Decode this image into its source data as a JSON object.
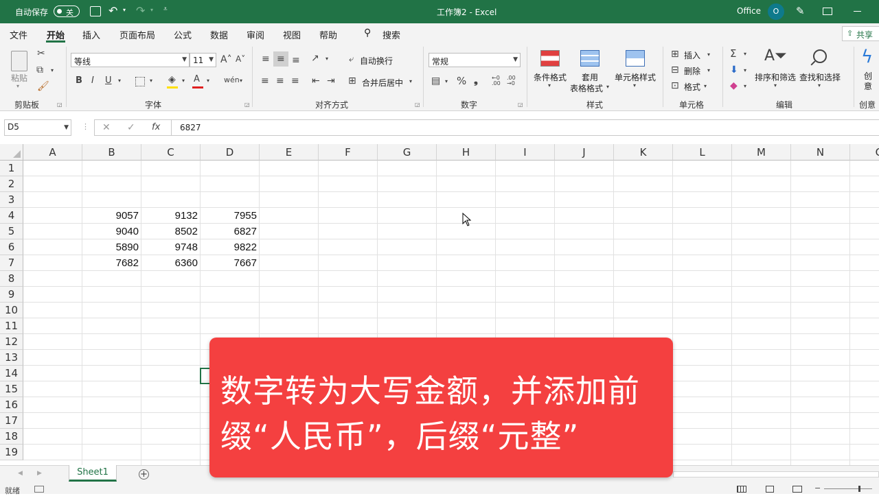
{
  "title_bar": {
    "autosave_label": "自动保存",
    "autosave_toggle": "关",
    "doc_title": "工作簿2  -  Excel",
    "account": "Office",
    "avatar_initial": "O",
    "bg_color": "#217346"
  },
  "menu": {
    "items": [
      "文件",
      "开始",
      "插入",
      "页面布局",
      "公式",
      "数据",
      "审阅",
      "视图",
      "帮助"
    ],
    "active": "开始",
    "search": "搜索",
    "share": "共享"
  },
  "ribbon": {
    "clipboard": {
      "paste": "粘贴",
      "group": "剪贴板"
    },
    "font": {
      "family": "等线",
      "size": "11",
      "group": "字体"
    },
    "align": {
      "wrap": "自动换行",
      "merge": "合并后居中",
      "group": "对齐方式"
    },
    "number": {
      "format": "常规",
      "group": "数字"
    },
    "styles": {
      "cond": "条件格式",
      "table_a": "套用",
      "table_b": "表格格式",
      "cell": "单元格样式",
      "group": "样式"
    },
    "cells": {
      "insert": "插入",
      "delete": "删除",
      "format": "格式",
      "group": "单元格"
    },
    "editing": {
      "sort": "排序和筛选",
      "find": "查找和选择",
      "group": "编辑"
    },
    "creative": {
      "label": "创意",
      "group": "创意"
    }
  },
  "formula_bar": {
    "name_box": "D5",
    "fx": "fx",
    "value": "6827"
  },
  "columns": [
    "A",
    "B",
    "C",
    "D",
    "E",
    "F",
    "G",
    "H",
    "I",
    "J",
    "K",
    "L",
    "M",
    "N",
    "O"
  ],
  "rows": [
    "1",
    "2",
    "3",
    "4",
    "5",
    "6",
    "7",
    "8",
    "9",
    "10",
    "11",
    "12",
    "13",
    "14",
    "15",
    "16",
    "17",
    "18",
    "19"
  ],
  "table": [
    [
      "9057",
      "9132",
      "7955"
    ],
    [
      "9040",
      "8502",
      "6827"
    ],
    [
      "5890",
      "9748",
      "9822"
    ],
    [
      "7682",
      "6360",
      "7667"
    ]
  ],
  "sheets": {
    "tabs": [
      "Sheet1"
    ]
  },
  "status": {
    "ready": "就绪"
  },
  "overlay": {
    "line1": "数字转为大写金额，并添加前",
    "line2": "缀“人民币”，后缀“元整”",
    "color": "#f44040"
  }
}
